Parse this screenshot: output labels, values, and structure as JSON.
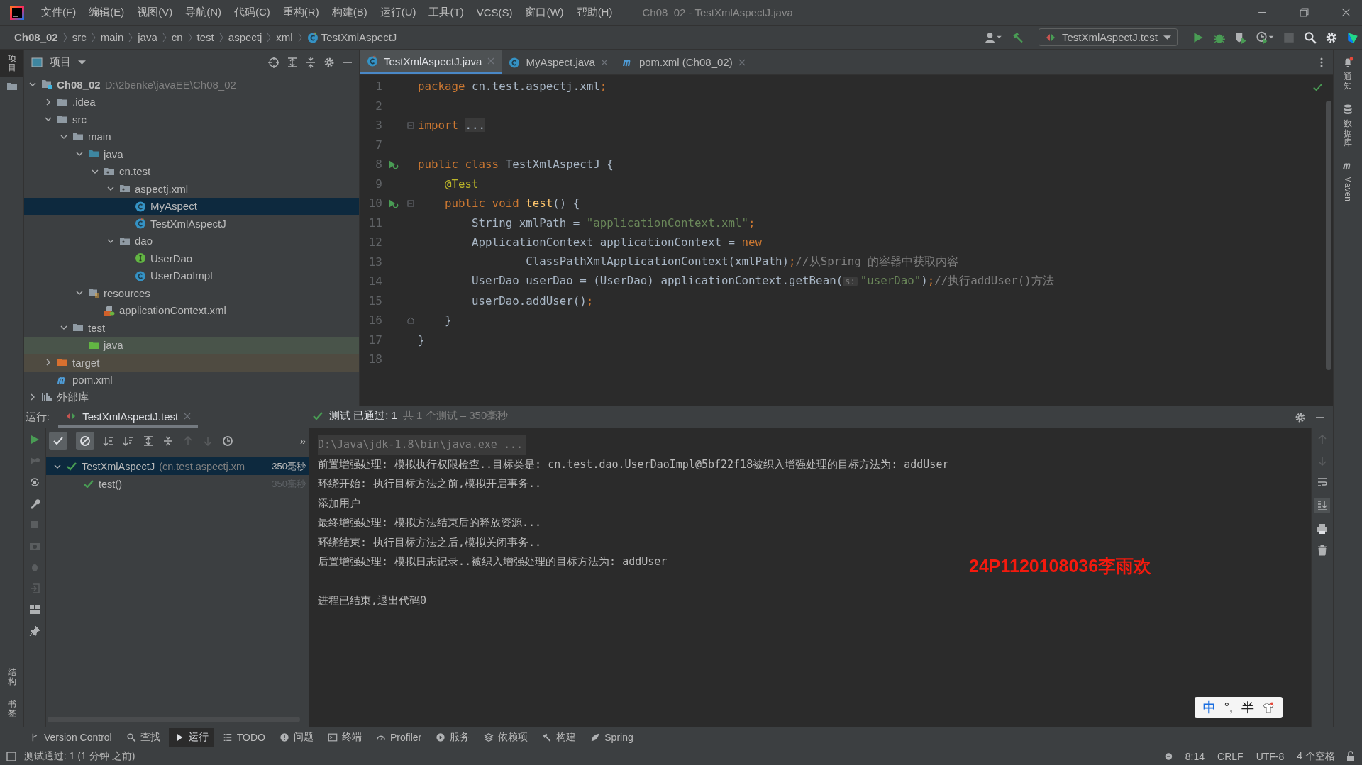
{
  "window": {
    "title": "Ch08_02 - TestXmlAspectJ.java"
  },
  "menu": [
    "文件(F)",
    "编辑(E)",
    "视图(V)",
    "导航(N)",
    "代码(C)",
    "重构(R)",
    "构建(B)",
    "运行(U)",
    "工具(T)",
    "VCS(S)",
    "窗口(W)",
    "帮助(H)"
  ],
  "breadcrumbs": [
    {
      "label": "Ch08_02",
      "kind": "project"
    },
    {
      "label": "src",
      "kind": "dir"
    },
    {
      "label": "main",
      "kind": "dir"
    },
    {
      "label": "java",
      "kind": "dir"
    },
    {
      "label": "cn",
      "kind": "dir"
    },
    {
      "label": "test",
      "kind": "dir"
    },
    {
      "label": "aspectj",
      "kind": "dir"
    },
    {
      "label": "xml",
      "kind": "dir"
    },
    {
      "label": "TestXmlAspectJ",
      "kind": "test-class"
    }
  ],
  "run_config": "TestXmlAspectJ.test",
  "left_strip": {
    "top": [
      {
        "label": "项目",
        "selected": true
      }
    ],
    "bottom": [
      {
        "label": "结构",
        "selected": false
      },
      {
        "label": "书签",
        "selected": false
      }
    ]
  },
  "right_strip": [
    {
      "label": "通知",
      "kind": "bell"
    },
    {
      "label": "数据库",
      "kind": "database"
    },
    {
      "label": "Maven",
      "kind": "maven"
    }
  ],
  "project": {
    "title": "项目",
    "tree": [
      {
        "label": "Ch08_02",
        "path": "D:\\2benke\\javaEE\\Ch08_02",
        "kind": "module",
        "expanded": true,
        "selected": false,
        "children": [
          {
            "label": ".idea",
            "kind": "folder",
            "expanded": false,
            "selected": false
          },
          {
            "label": "src",
            "kind": "folder",
            "expanded": true,
            "selected": false,
            "children": [
              {
                "label": "main",
                "kind": "folder",
                "expanded": true,
                "selected": false,
                "children": [
                  {
                    "label": "java",
                    "kind": "source-root",
                    "expanded": true,
                    "selected": false,
                    "children": [
                      {
                        "label": "cn.test",
                        "kind": "package",
                        "expanded": true,
                        "selected": false,
                        "children": [
                          {
                            "label": "aspectj.xml",
                            "kind": "package",
                            "expanded": true,
                            "selected": false,
                            "children": [
                              {
                                "label": "MyAspect",
                                "kind": "class",
                                "selected": true
                              },
                              {
                                "label": "TestXmlAspectJ",
                                "kind": "test-class",
                                "selected": false
                              }
                            ]
                          },
                          {
                            "label": "dao",
                            "kind": "package",
                            "expanded": true,
                            "selected": false,
                            "children": [
                              {
                                "label": "UserDao",
                                "kind": "interface",
                                "selected": false
                              },
                              {
                                "label": "UserDaoImpl",
                                "kind": "class",
                                "selected": false
                              }
                            ]
                          }
                        ]
                      }
                    ]
                  },
                  {
                    "label": "resources",
                    "kind": "resources",
                    "expanded": true,
                    "selected": false,
                    "children": [
                      {
                        "label": "applicationContext.xml",
                        "kind": "spring-xml",
                        "selected": false
                      }
                    ]
                  }
                ]
              },
              {
                "label": "test",
                "kind": "folder",
                "expanded": true,
                "selected": false,
                "children": [
                  {
                    "label": "java",
                    "kind": "test-root",
                    "selected": false
                  }
                ]
              }
            ]
          },
          {
            "label": "target",
            "kind": "excluded",
            "expanded": false,
            "selected": false
          },
          {
            "label": "pom.xml",
            "kind": "maven",
            "selected": false
          }
        ]
      },
      {
        "label": "外部库",
        "kind": "library",
        "expanded": false,
        "selected": false
      }
    ]
  },
  "editor": {
    "tabs": [
      {
        "label": "TestXmlAspectJ.java",
        "kind": "test-class",
        "selected": true
      },
      {
        "label": "MyAspect.java",
        "kind": "class",
        "selected": false
      },
      {
        "label": "pom.xml (Ch08_02)",
        "kind": "maven",
        "selected": false
      }
    ],
    "lines": [
      {
        "number": "1",
        "tokens": [
          {
            "kind": "keyword",
            "text": "package"
          },
          {
            "kind": "plain",
            "text": " cn.test.aspectj.xml"
          },
          {
            "kind": "keyword",
            "text": ";"
          }
        ]
      },
      {
        "number": "2"
      },
      {
        "number": "3",
        "kind": "fold",
        "tokens": [
          {
            "kind": "keyword",
            "text": "import "
          },
          {
            "kind": "folded",
            "text": "..."
          }
        ]
      },
      {
        "number": "7"
      },
      {
        "number": "8",
        "kind": "run",
        "tokens": [
          {
            "kind": "keyword",
            "text": "public class "
          },
          {
            "kind": "plain",
            "text": "TestXmlAspectJ {"
          }
        ]
      },
      {
        "number": "9",
        "tokens": [
          {
            "kind": "annotation",
            "text": "    @Test"
          }
        ]
      },
      {
        "number": "10",
        "kind": "run-fold",
        "tokens": [
          {
            "kind": "keyword",
            "text": "    public void "
          },
          {
            "kind": "method",
            "text": "test"
          },
          {
            "kind": "plain",
            "text": "() {"
          }
        ]
      },
      {
        "number": "11",
        "tokens": [
          {
            "kind": "plain",
            "text": "        String xmlPath = "
          },
          {
            "kind": "string",
            "text": "\"applicationContext.xml\""
          },
          {
            "kind": "keyword",
            "text": ";"
          }
        ]
      },
      {
        "number": "12",
        "tokens": [
          {
            "kind": "plain",
            "text": "        ApplicationContext applicationContext = "
          },
          {
            "kind": "keyword",
            "text": "new"
          }
        ]
      },
      {
        "number": "13",
        "tokens": [
          {
            "kind": "plain",
            "text": "                ClassPathXmlApplicationContext(xmlPath)"
          },
          {
            "kind": "keyword",
            "text": ";"
          },
          {
            "kind": "comment",
            "text": "//从Spring 的容器中获取内容"
          }
        ]
      },
      {
        "number": "14",
        "tokens": [
          {
            "kind": "plain",
            "text": "        UserDao userDao = (UserDao) applicationContext.getBean("
          },
          {
            "kind": "hint",
            "text": "s:"
          },
          {
            "kind": "string",
            "text": "\"userDao\""
          },
          {
            "kind": "plain",
            "text": ")"
          },
          {
            "kind": "keyword",
            "text": ";"
          },
          {
            "kind": "comment",
            "text": "//执行addUser()方法"
          }
        ]
      },
      {
        "number": "15",
        "tokens": [
          {
            "kind": "plain",
            "text": "        userDao.addUser()"
          },
          {
            "kind": "keyword",
            "text": ";"
          }
        ]
      },
      {
        "number": "16",
        "kind": "fold-end",
        "tokens": [
          {
            "kind": "plain",
            "text": "    }"
          }
        ]
      },
      {
        "number": "17",
        "tokens": [
          {
            "kind": "plain",
            "text": "}"
          }
        ]
      },
      {
        "number": "18"
      }
    ]
  },
  "run": {
    "label": "运行:",
    "tab": "TestXmlAspectJ.test",
    "more": "»",
    "status": "测试 已通过: 1",
    "status_detail": "共 1 个测试 – 350毫秒",
    "tests": [
      {
        "name": "TestXmlAspectJ",
        "detail": "(cn.test.aspectj.xm",
        "time": "350毫秒",
        "selected": true,
        "expanded": true,
        "children": [
          {
            "name": "test()",
            "time": "350毫秒",
            "selected": false
          }
        ]
      }
    ],
    "console": [
      {
        "kind": "command",
        "text": "D:\\Java\\jdk-1.8\\bin\\java.exe ..."
      },
      {
        "kind": "output",
        "text": "前置增强处理: 模拟执行权限检查..目标类是: cn.test.dao.UserDaoImpl@5bf22f18被织入增强处理的目标方法为: addUser"
      },
      {
        "kind": "output",
        "text": "环绕开始: 执行目标方法之前,模拟开启事务.."
      },
      {
        "kind": "output",
        "text": "添加用户"
      },
      {
        "kind": "output",
        "text": "最终增强处理: 模拟方法结束后的释放资源..."
      },
      {
        "kind": "output",
        "text": "环绕结束: 执行目标方法之后,模拟关闭事务.."
      },
      {
        "kind": "output",
        "text": "后置增强处理: 模拟日志记录..被织入增强处理的目标方法为: addUser"
      },
      {
        "kind": "blank"
      },
      {
        "kind": "output",
        "text": "进程已结束,退出代码0"
      }
    ]
  },
  "overlay_label": "24P1120108036李雨欢",
  "ime": {
    "mode": "中",
    "punctuation": "°,",
    "width": "半"
  },
  "tool_tabs": [
    {
      "label": "Version Control",
      "kind": "branch",
      "selected": false
    },
    {
      "label": "查找",
      "kind": "search",
      "selected": false
    },
    {
      "label": "运行",
      "kind": "play",
      "selected": true
    },
    {
      "label": "TODO",
      "kind": "list",
      "selected": false
    },
    {
      "label": "问题",
      "kind": "info",
      "selected": false
    },
    {
      "label": "终端",
      "kind": "terminal",
      "selected": false
    },
    {
      "label": "Profiler",
      "kind": "gauge",
      "selected": false
    },
    {
      "label": "服务",
      "kind": "play-circle",
      "selected": false
    },
    {
      "label": "依赖项",
      "kind": "layers",
      "selected": false
    },
    {
      "label": "构建",
      "kind": "hammer",
      "selected": false
    },
    {
      "label": "Spring",
      "kind": "leaf",
      "selected": false
    }
  ],
  "status_bar": {
    "message": "测试通过: 1 (1 分钟 之前)",
    "items": [
      "8:14",
      "CRLF",
      "UTF-8",
      "4 个空格"
    ]
  }
}
